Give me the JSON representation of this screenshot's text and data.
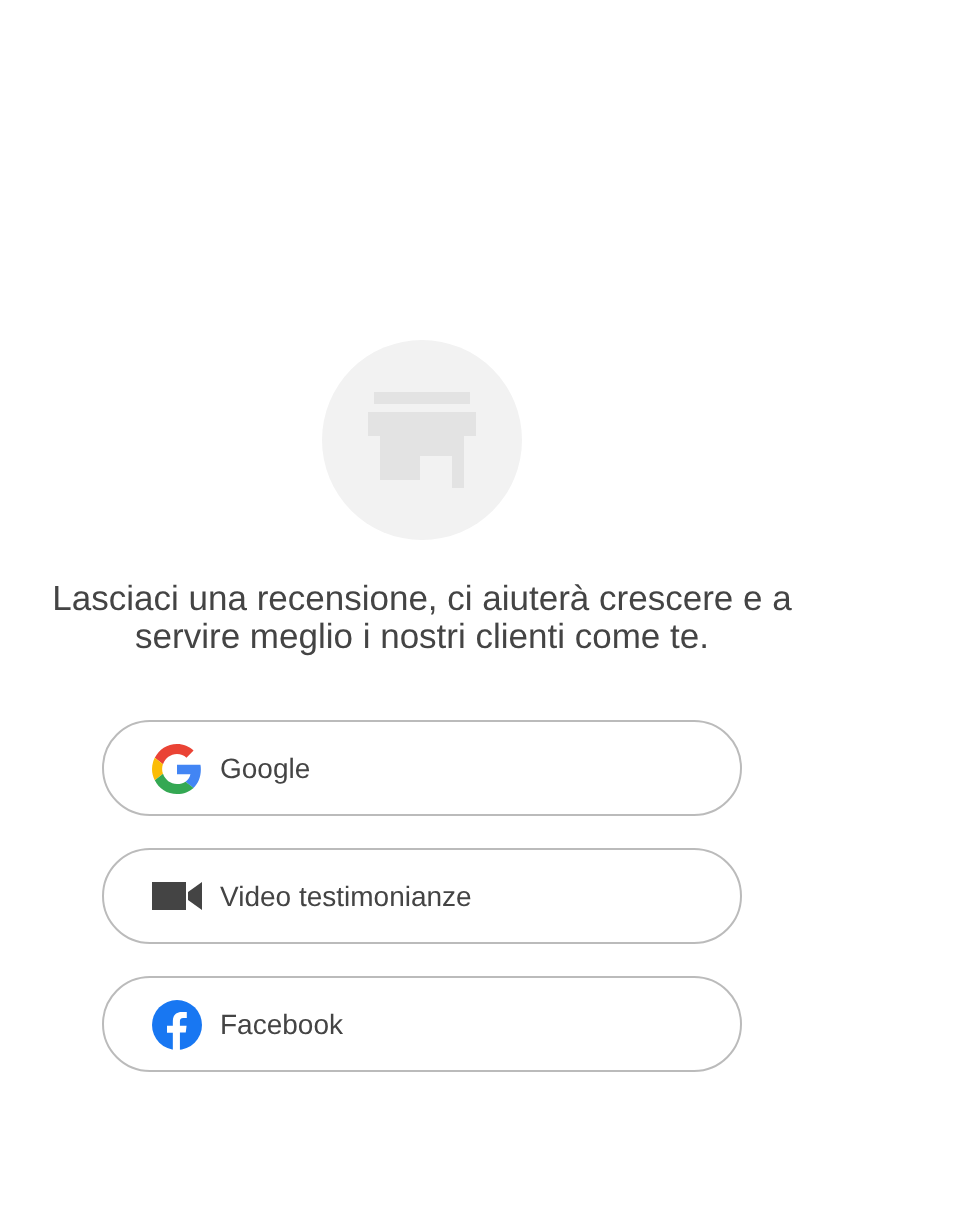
{
  "message": "Lasciaci una recensione, ci aiuterà crescere e a servire meglio i nostri clienti come te.",
  "buttons": [
    {
      "kind": "google",
      "label": "Google"
    },
    {
      "kind": "video",
      "label": "Video testimonianze"
    },
    {
      "kind": "facebook",
      "label": "Facebook"
    }
  ]
}
